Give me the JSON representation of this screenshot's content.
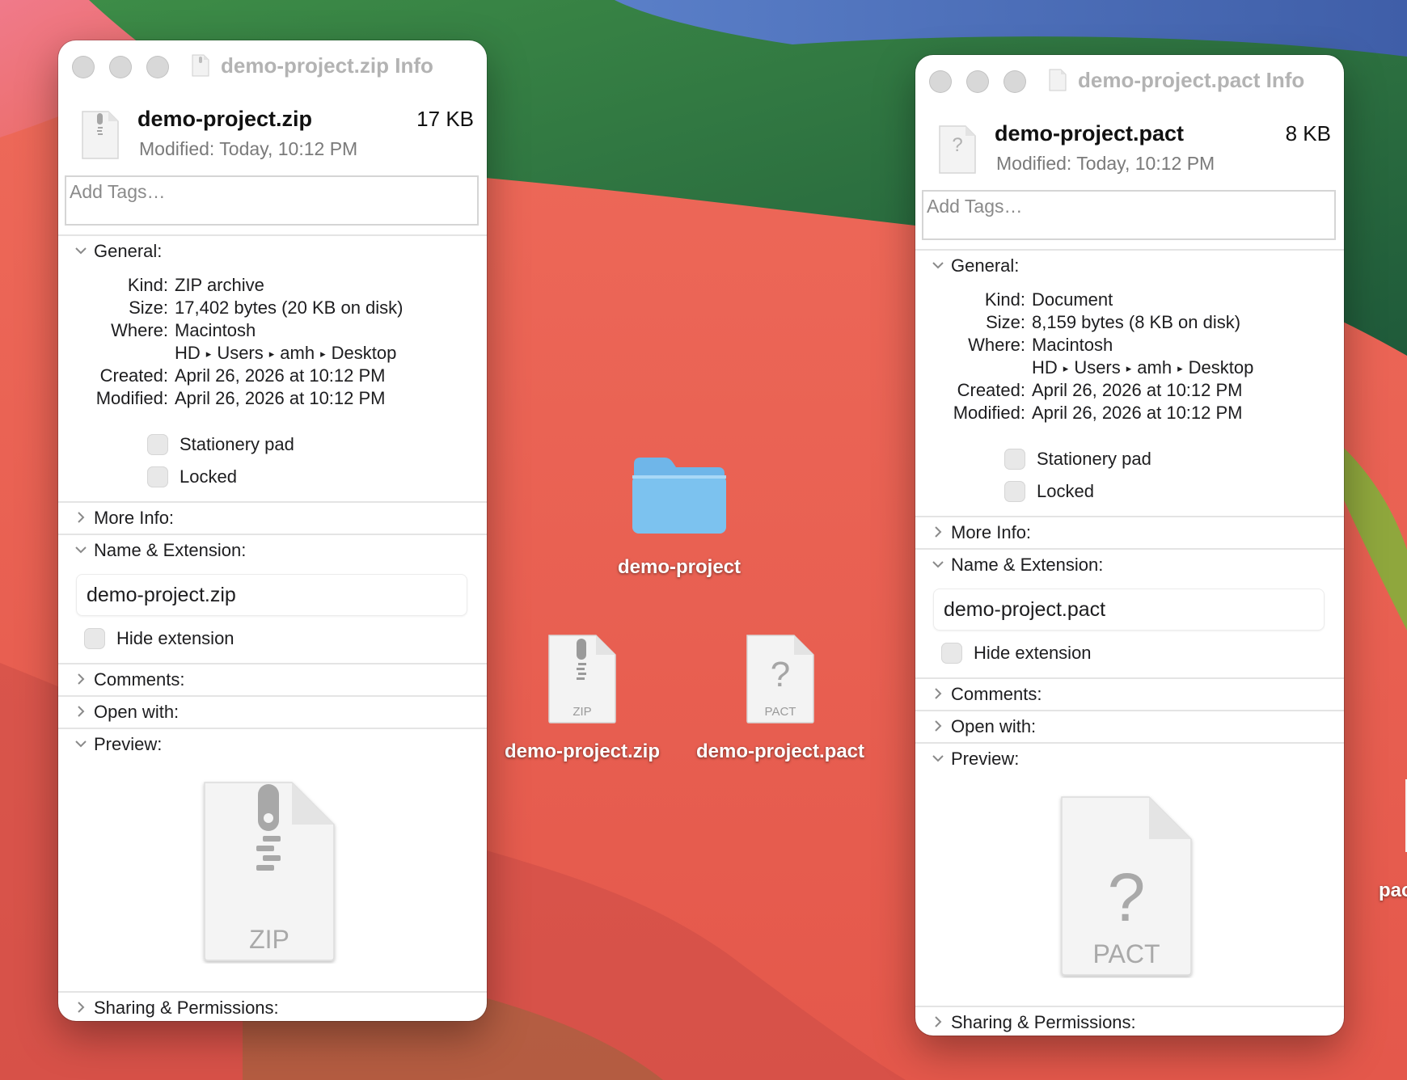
{
  "colors": {
    "wallpaper_base": "#e96456",
    "wallpaper_green": "#2f7a44",
    "wallpaper_blue": "#4f6fb8",
    "folder_blue": "#7cc2ef",
    "window_bg": "#ffffff",
    "title_gray": "#b3b3b3"
  },
  "desktop": {
    "folder": {
      "label": "demo-project",
      "icon": "folder-icon"
    },
    "zip_file": {
      "label": "demo-project.zip",
      "badge": "ZIP",
      "icon": "zip-archive-icon"
    },
    "pact_file": {
      "label": "demo-project.pact",
      "badge": "PACT",
      "icon": "generic-document-icon",
      "glyph": "?"
    },
    "partial_item": {
      "label": "pac"
    }
  },
  "zip_window": {
    "title": "demo-project.zip Info",
    "name": "demo-project.zip",
    "size_short": "17 KB",
    "modified_short": "Modified:  Today, 10:12 PM",
    "tags_placeholder": "Add Tags…",
    "sections": {
      "general": "General:",
      "more_info": "More Info:",
      "name_ext": "Name & Extension:",
      "comments": "Comments:",
      "open_with": "Open with:",
      "preview": "Preview:",
      "sharing": "Sharing & Permissions:"
    },
    "general": {
      "kind_label": "Kind:",
      "kind": "ZIP archive",
      "size_label": "Size:",
      "size": "17,402 bytes (20 KB on disk)",
      "where_label": "Where:",
      "where_parts": [
        "Macintosh HD",
        "Users",
        "amh",
        "Desktop"
      ],
      "path_separator": "▸",
      "created_label": "Created:",
      "created": "April 26, 2026 at 10:12 PM",
      "modified_label": "Modified:",
      "modified": "April 26, 2026 at 10:12 PM"
    },
    "stationery_label": "Stationery pad",
    "locked_label": "Locked",
    "name_field_value": "demo-project.zip",
    "hide_extension_label": "Hide extension",
    "preview_badge": "ZIP"
  },
  "pact_window": {
    "title": "demo-project.pact Info",
    "name": "demo-project.pact",
    "size_short": "8 KB",
    "modified_short": "Modified:  Today, 10:12 PM",
    "tags_placeholder": "Add Tags…",
    "sections": {
      "general": "General:",
      "more_info": "More Info:",
      "name_ext": "Name & Extension:",
      "comments": "Comments:",
      "open_with": "Open with:",
      "preview": "Preview:",
      "sharing": "Sharing & Permissions:"
    },
    "general": {
      "kind_label": "Kind:",
      "kind": "Document",
      "size_label": "Size:",
      "size": "8,159 bytes (8 KB on disk)",
      "where_label": "Where:",
      "where_parts": [
        "Macintosh HD",
        "Users",
        "amh",
        "Desktop"
      ],
      "path_separator": "▸",
      "created_label": "Created:",
      "created": "April 26, 2026 at 10:12 PM",
      "modified_label": "Modified:",
      "modified": "April 26, 2026 at 10:12 PM"
    },
    "stationery_label": "Stationery pad",
    "locked_label": "Locked",
    "name_field_value": "demo-project.pact",
    "hide_extension_label": "Hide extension",
    "preview_badge": "PACT",
    "preview_glyph": "?"
  }
}
